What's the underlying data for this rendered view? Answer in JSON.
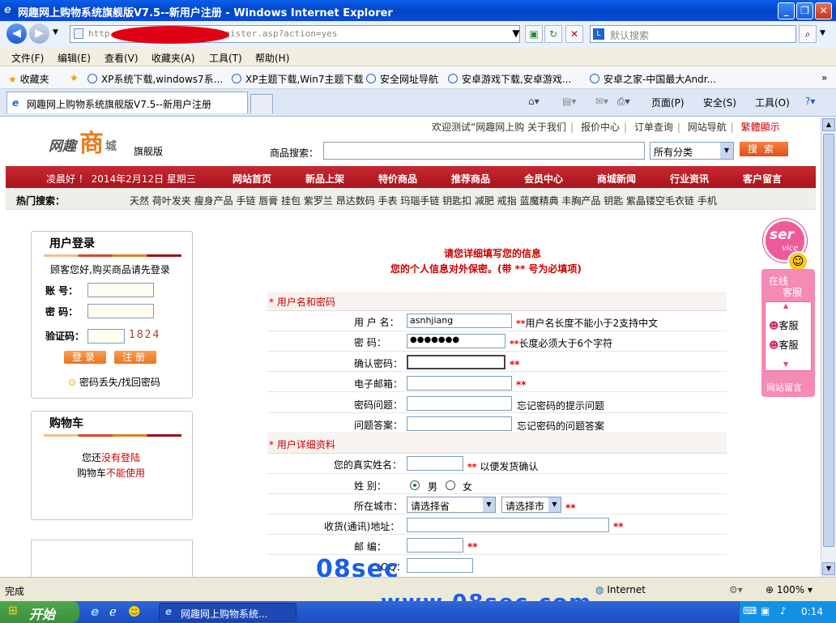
{
  "window": {
    "title": "网趣网上购物系统旗舰版V7.5--新用户注册 - Windows Internet Explorer",
    "buttons": [
      "_",
      "❐",
      "✕"
    ]
  },
  "address": {
    "url": "http://[redacted]/register.asp?action=yes",
    "url_visible": "http",
    "url_tail": "/register.asp?action=yes",
    "search_placeholder": "默认搜索"
  },
  "menu": [
    "文件(F)",
    "编辑(E)",
    "查看(V)",
    "收藏夹(A)",
    "工具(T)",
    "帮助(H)"
  ],
  "favorites_bar": {
    "label": "收藏夹",
    "items": [
      "XP系统下载,windows7系...",
      "XP主题下载,Win7主题下载",
      "安全网址导航",
      "安卓游戏下载,安卓游戏...",
      "安卓之家-中国最大Andr..."
    ]
  },
  "tabs": {
    "active": "网趣网上购物系统旗舰版V7.5--新用户注册",
    "tools": [
      "页面(P)",
      "安全(S)",
      "工具(O)"
    ]
  },
  "site": {
    "logo_text": "网趣商城",
    "logo_word1": "网趣",
    "logo_word2": "商",
    "logo_word3": "城",
    "edition": "旗舰版",
    "welcome": "欢迎测试“网趣网上购",
    "top_links": [
      "关于我们",
      "报价中心",
      "订单查询",
      "网站导航"
    ],
    "top_link_red": "繁體顯示",
    "search_label": "商品搜索：",
    "search_value": "",
    "category": "所有分类",
    "search_button": "搜索",
    "greeting": "凌晨好 ！  2014年2月12日 星期三",
    "nav": [
      "网站首页",
      "新品上架",
      "特价商品",
      "推荐商品",
      "会员中心",
      "商城新闻",
      "行业资讯",
      "客户留言"
    ],
    "hot_label": "热门搜索：",
    "hot_keywords": "天然  荷叶发夹  瘦身产品  手链  唇膏  挂包  紫罗兰  昂达数码  手表  玛瑙手链  钥匙扣  减肥  戒指  蓝魔精典  丰胸产品  钥匙  紫晶镂空毛衣链  手机"
  },
  "login": {
    "heading": "用户登录",
    "note": "顾客您好,购买商品请先登录",
    "account_label": "账  号：",
    "password_label": "密  码：",
    "captcha_label": "验证码：",
    "captcha_code": "1824",
    "login_button": "登录",
    "register_button": "注册",
    "forgot": "密码丢失/找回密码"
  },
  "cart": {
    "heading": "购物车",
    "line1_a": "您还",
    "line1_b": "没有登陆",
    "line2_a": "购物车",
    "line2_b": "不能使用"
  },
  "form": {
    "intro1": "请您详细填写您的信息",
    "intro2": "您的个人信息对外保密。(带 ** 号为必填项)",
    "section1": "* 用户名和密码",
    "section2": "* 用户详细资料",
    "username_label": "用 户 名：",
    "username_value": "asnhjiang",
    "username_hint": "用户名长度不能小于2支持中文",
    "password_label": "密    码：",
    "password_value": "●●●●●●●",
    "password_hint": "长度必须大于6个字符",
    "confirm_label": "确认密码：",
    "email_label": "电子邮箱：",
    "question_label": "密码问题：",
    "question_hint": "忘记密码的提示问题",
    "answer_label": "问题答案：",
    "answer_hint": "忘记密码的问题答案",
    "realname_label": "您的真实姓名：",
    "realname_hint": "以便发货确认",
    "gender_label": "姓    别：",
    "gender_male": "男",
    "gender_female": "女",
    "city_label": "所在城市：",
    "province": "请选择省",
    "city": "请选择市",
    "address_label": "收货(通讯)地址：",
    "postcode_label": "邮    编：",
    "qq_label": "QQ：",
    "required_mark": "**"
  },
  "service": {
    "badge": "ser",
    "badge2": "vice",
    "title1": "在线",
    "title2": "客服",
    "agent": "客服",
    "message": "网站留言"
  },
  "status": {
    "left": "完成",
    "zone": "Internet",
    "zoom": "100%"
  },
  "taskbar": {
    "start": "开始",
    "task": "网趣网上购物系统...",
    "time": "0:14"
  },
  "watermark": {
    "top": "08sec",
    "bottom": "www.08sec.com"
  }
}
